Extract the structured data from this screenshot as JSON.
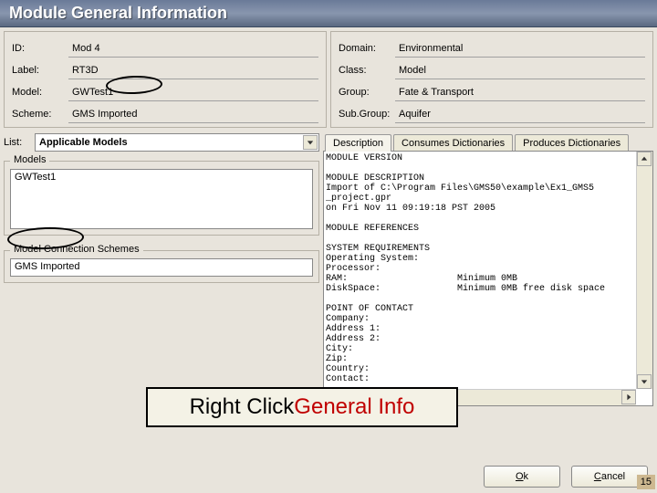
{
  "title": "Module General Information",
  "fieldsLeft": {
    "idLabel": "ID:",
    "idVal": "Mod 4",
    "labelLabel": "Label:",
    "labelVal": "RT3D",
    "modelLabel": "Model:",
    "modelVal": "GWTest1",
    "schemeLabel": "Scheme:",
    "schemeVal": "GMS Imported"
  },
  "fieldsRight": {
    "domainLabel": "Domain:",
    "domainVal": "Environmental",
    "classLabel": "Class:",
    "classVal": "Model",
    "groupLabel": "Group:",
    "groupVal": "Fate & Transport",
    "subgroupLabel": "Sub.Group:",
    "subgroupVal": "Aquifer"
  },
  "list": {
    "label": "List:",
    "selected": "Applicable Models"
  },
  "panels": {
    "modelsTitle": "Models",
    "modelsItem": "GWTest1",
    "schemesTitle": "Model Connection Schemes",
    "schemesItem": "GMS Imported"
  },
  "tabs": {
    "desc": "Description",
    "cons": "Consumes Dictionaries",
    "prod": "Produces Dictionaries"
  },
  "description": "MODULE VERSION\n\nMODULE DESCRIPTION\nImport of C:\\Program Files\\GMS50\\example\\Ex1_GMS5\n_project.gpr\non Fri Nov 11 09:19:18 PST 2005\n\nMODULE REFERENCES\n\nSYSTEM REQUIREMENTS\nOperating System:\nProcessor:\nRAM:                    Minimum 0MB\nDiskSpace:              Minimum 0MB free disk space\n\nPOINT OF CONTACT\nCompany:\nAddress 1:\nAddress 2:\nCity:\nZip:\nCountry:\nContact:",
  "buttons": {
    "ok_u": "O",
    "ok_rest": "k",
    "cancel_u": "C",
    "cancel_rest": "ancel"
  },
  "callout": {
    "black": "Right Click ",
    "red": "General Info"
  },
  "pageNum": "15"
}
